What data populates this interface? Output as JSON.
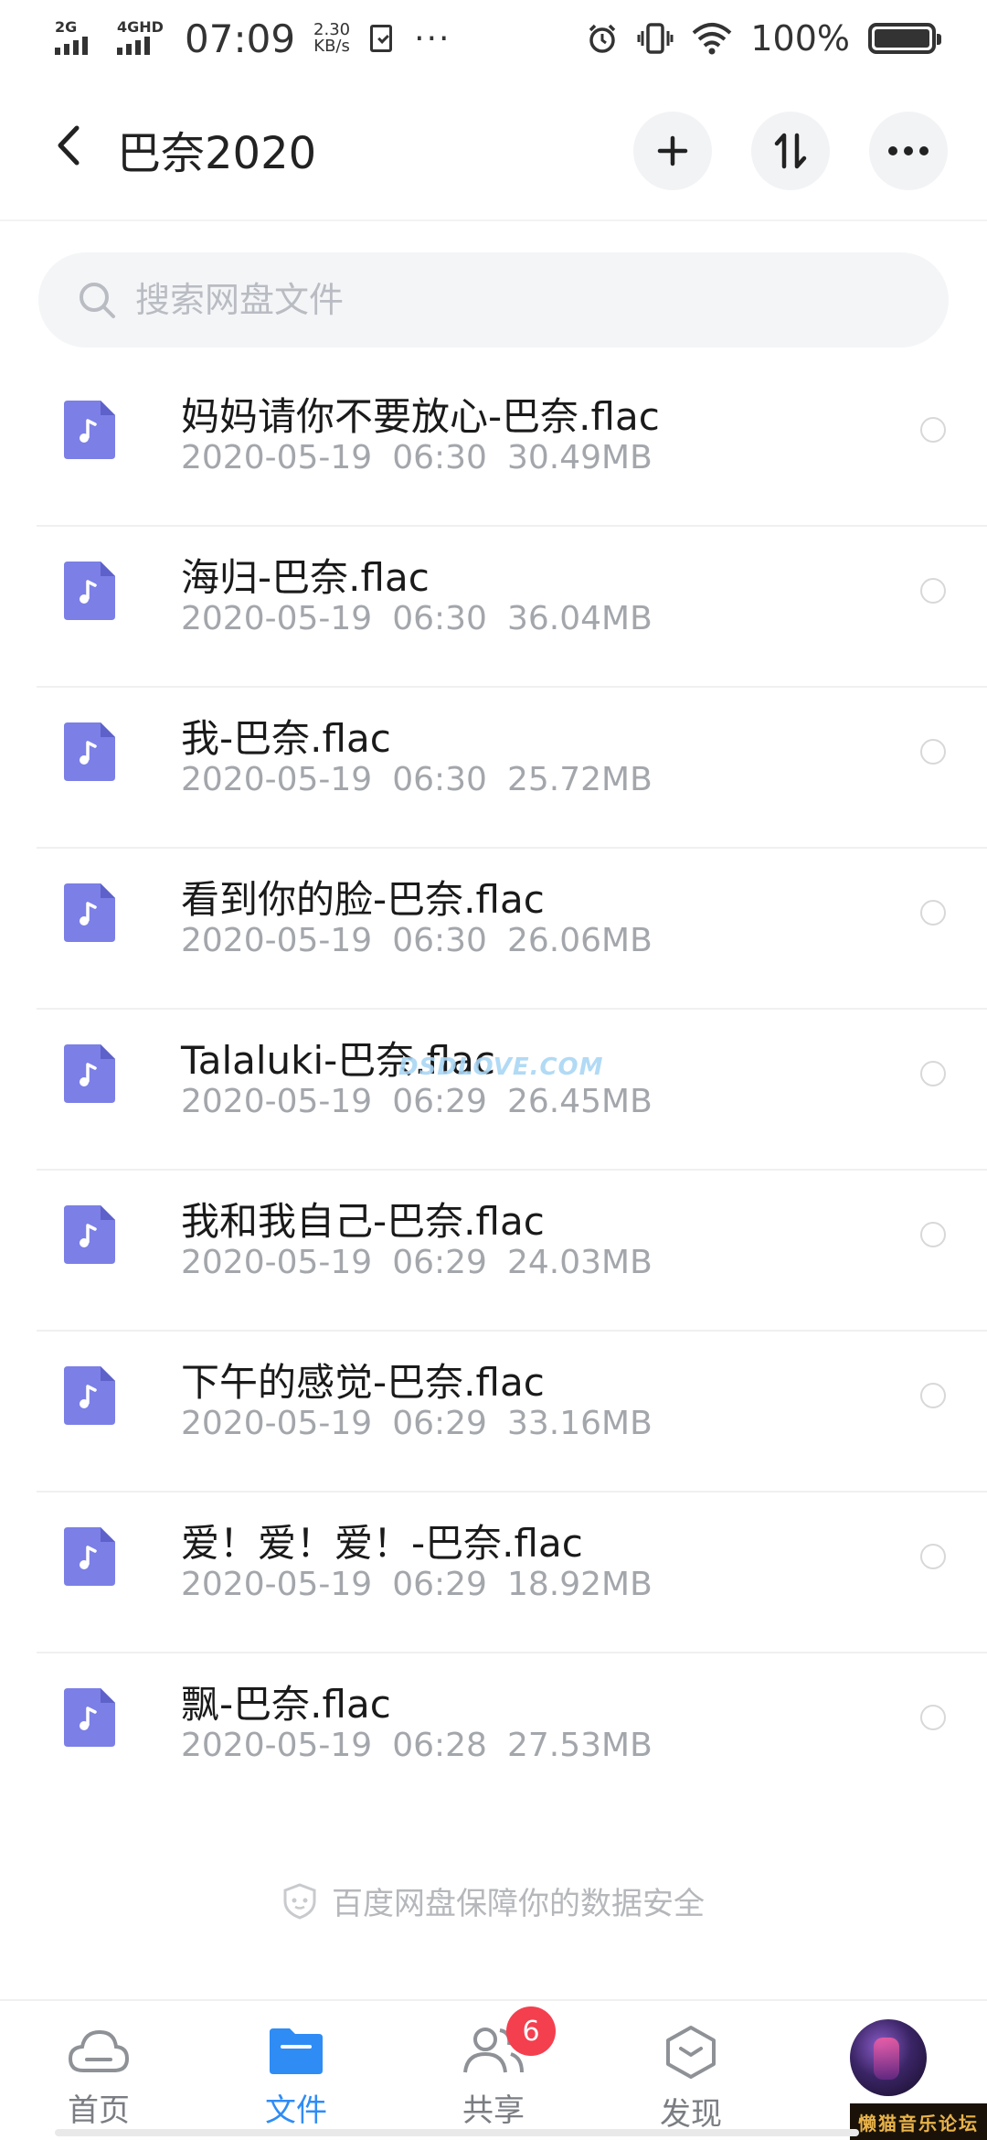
{
  "status_bar": {
    "sim1": "2G",
    "sim2": "4GHD",
    "time": "07:09",
    "speed_value": "2.30",
    "speed_unit": "KB/s",
    "more": "···",
    "battery": "100%"
  },
  "header": {
    "title": "巴奈2020",
    "icons": [
      "back-icon",
      "add-icon",
      "sort-icon",
      "more-icon"
    ]
  },
  "search": {
    "placeholder": "搜索网盘文件"
  },
  "files": [
    {
      "name": "妈妈请你不要放心-巴奈.flac",
      "date": "2020-05-19",
      "time": "06:30",
      "size": "30.49MB"
    },
    {
      "name": "海归-巴奈.flac",
      "date": "2020-05-19",
      "time": "06:30",
      "size": "36.04MB"
    },
    {
      "name": "我-巴奈.flac",
      "date": "2020-05-19",
      "time": "06:30",
      "size": "25.72MB"
    },
    {
      "name": "看到你的脸-巴奈.flac",
      "date": "2020-05-19",
      "time": "06:30",
      "size": "26.06MB"
    },
    {
      "name": "Talaluki-巴奈.flac",
      "date": "2020-05-19",
      "time": "06:29",
      "size": "26.45MB"
    },
    {
      "name": "我和我自己-巴奈.flac",
      "date": "2020-05-19",
      "time": "06:29",
      "size": "24.03MB"
    },
    {
      "name": "下午的感觉-巴奈.flac",
      "date": "2020-05-19",
      "time": "06:29",
      "size": "33.16MB"
    },
    {
      "name": "爱！爱！爱！-巴奈.flac",
      "date": "2020-05-19",
      "time": "06:29",
      "size": "18.92MB"
    },
    {
      "name": "飘-巴奈.flac",
      "date": "2020-05-19",
      "time": "06:28",
      "size": "27.53MB"
    }
  ],
  "watermark": "DSDLOVE.COM",
  "footer_note": "百度网盘保障你的数据安全",
  "bottom_nav": {
    "items": [
      {
        "label": "首页",
        "icon": "cloud-icon"
      },
      {
        "label": "文件",
        "icon": "folder-icon",
        "active": true
      },
      {
        "label": "共享",
        "icon": "people-icon",
        "badge": "6"
      },
      {
        "label": "发现",
        "icon": "discover-icon"
      }
    ],
    "avatar": "avatar"
  },
  "forum_stamp": "懒猫音乐论坛",
  "colors": {
    "accent": "#2f8cf5",
    "file_icon": "#7b7fe6",
    "badge": "#f43f4f",
    "meta_text": "#a3a6ab"
  }
}
